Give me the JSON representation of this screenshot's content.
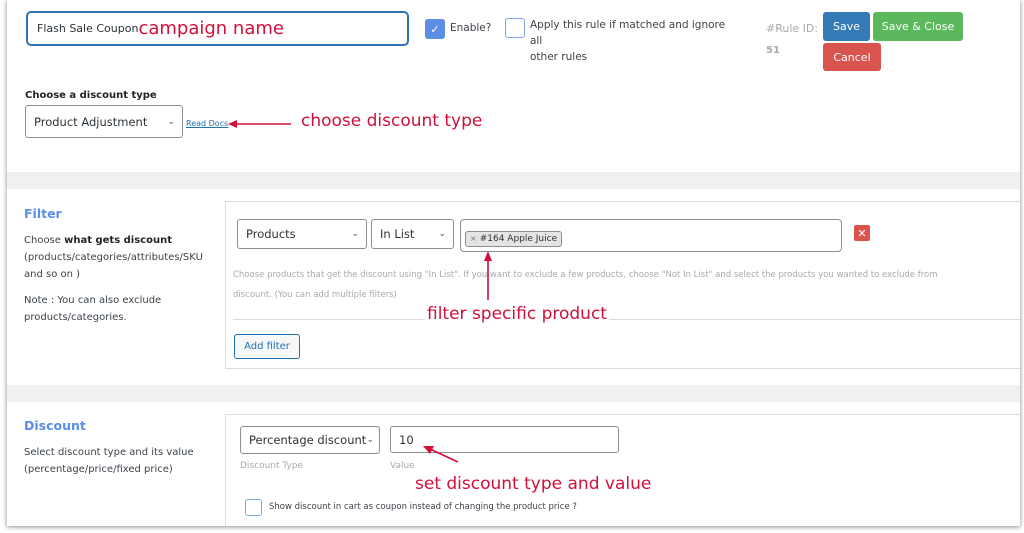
{
  "header": {
    "campaign_name": "Flash Sale Coupon",
    "enable_label": "Enable?",
    "enable_checked": true,
    "check_icon": "✓",
    "exclusive_label_line1": "Apply this rule if matched and ignore all",
    "exclusive_label_line2": "other rules",
    "exclusive_checked": false,
    "rule_id_label": "#Rule ID:",
    "rule_id_value": "51",
    "save_label": "Save",
    "save_close_label": "Save & Close",
    "cancel_label": "Cancel"
  },
  "discount_type": {
    "label": "Choose a discount type",
    "selected": "Product Adjustment",
    "read_docs": "Read Docs",
    "chevron_icon": "⌄"
  },
  "filter": {
    "title": "Filter",
    "desc_prefix": "Choose ",
    "desc_bold": "what gets discount",
    "desc_rest_line1": "(products/categories/attributes/SKU",
    "desc_rest_line2": "and so on )",
    "note_line1": "Note : You can also exclude",
    "note_line2": "products/categories.",
    "type_selected": "Products",
    "condition_selected": "In List",
    "tags": [
      {
        "remove": "×",
        "label": "#164 Apple Juice"
      }
    ],
    "remove_icon": "✕",
    "help_line1": "Choose products that get the discount using \"In List\". If you want to exclude a few products, choose \"Not In List\" and select the products you wanted to exclude from",
    "help_line2": "discount. (You can add multiple filters)",
    "add_filter_label": "Add filter"
  },
  "discount": {
    "title": "Discount",
    "desc_line1": "Select discount type and its value",
    "desc_line2": "(percentage/price/fixed price)",
    "type_selected": "Percentage discount",
    "type_caption": "Discount Type",
    "value": "10",
    "value_caption": "Value",
    "coupon_label": "Show discount in cart as coupon instead of changing the product price ?",
    "coupon_checked": false
  },
  "annotations": {
    "campaign_name": "campaign name",
    "discount_type": "choose discount type",
    "filter_product": "filter specific product",
    "discount_value": "set discount type and value"
  },
  "colors": {
    "accent_blue": "#337ab7",
    "save_close_green": "#5cb85c",
    "cancel_red": "#d9534f",
    "section_title": "#5c8ee6",
    "annotation_red": "#d0103a"
  }
}
